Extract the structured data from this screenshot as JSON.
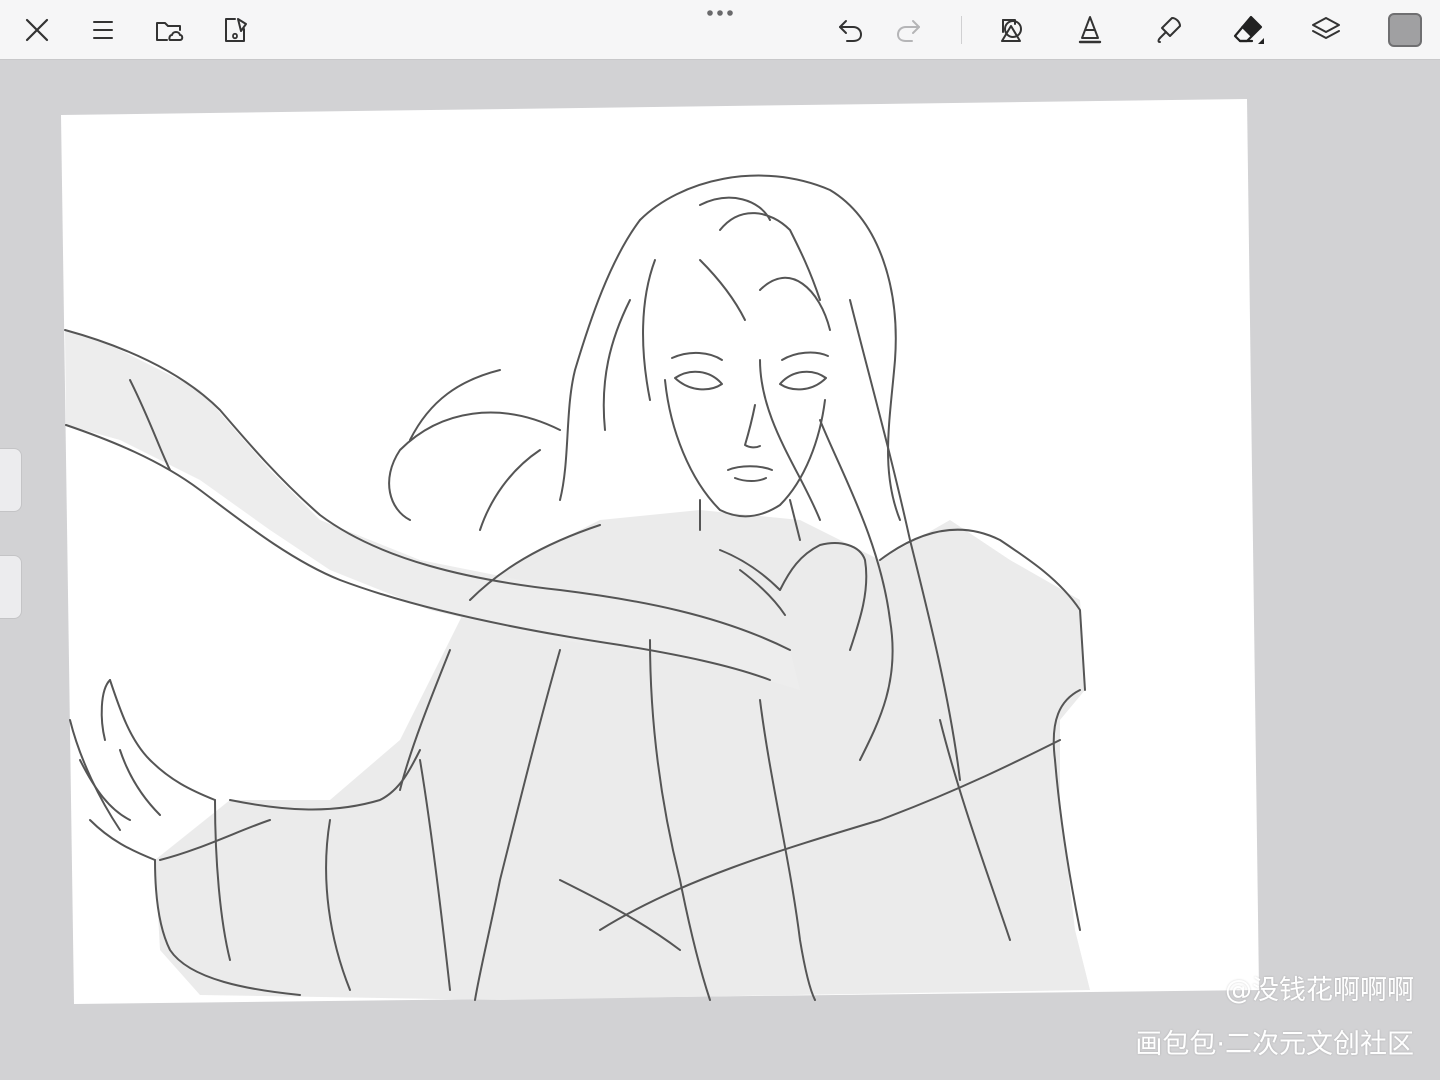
{
  "toolbar": {
    "left_tools": [
      {
        "id": "close",
        "icon": "close-icon"
      },
      {
        "id": "menu",
        "icon": "hamburger-menu-icon"
      },
      {
        "id": "gallery",
        "icon": "folder-cloud-icon"
      },
      {
        "id": "adjustments",
        "icon": "document-edit-icon"
      }
    ],
    "center_handle_icon": "more-dots-icon",
    "history": [
      {
        "id": "undo",
        "icon": "undo-icon",
        "enabled": true
      },
      {
        "id": "redo",
        "icon": "redo-icon",
        "enabled": false
      }
    ],
    "right_tools": [
      {
        "id": "shapes",
        "icon": "shapes-icon"
      },
      {
        "id": "brush",
        "icon": "brush-tip-icon"
      },
      {
        "id": "smudge",
        "icon": "smudge-icon"
      },
      {
        "id": "eraser",
        "icon": "eraser-icon",
        "active": true
      },
      {
        "id": "layers",
        "icon": "layers-icon"
      }
    ],
    "current_color": "#a0a0a2"
  },
  "canvas": {
    "background_color": "#ffffff",
    "sketch_color": "#555555",
    "fill_color": "#ebebeb"
  },
  "watermark": {
    "line1": "@没钱花啊啊啊",
    "line2": "画包包·二次元文创社区"
  }
}
